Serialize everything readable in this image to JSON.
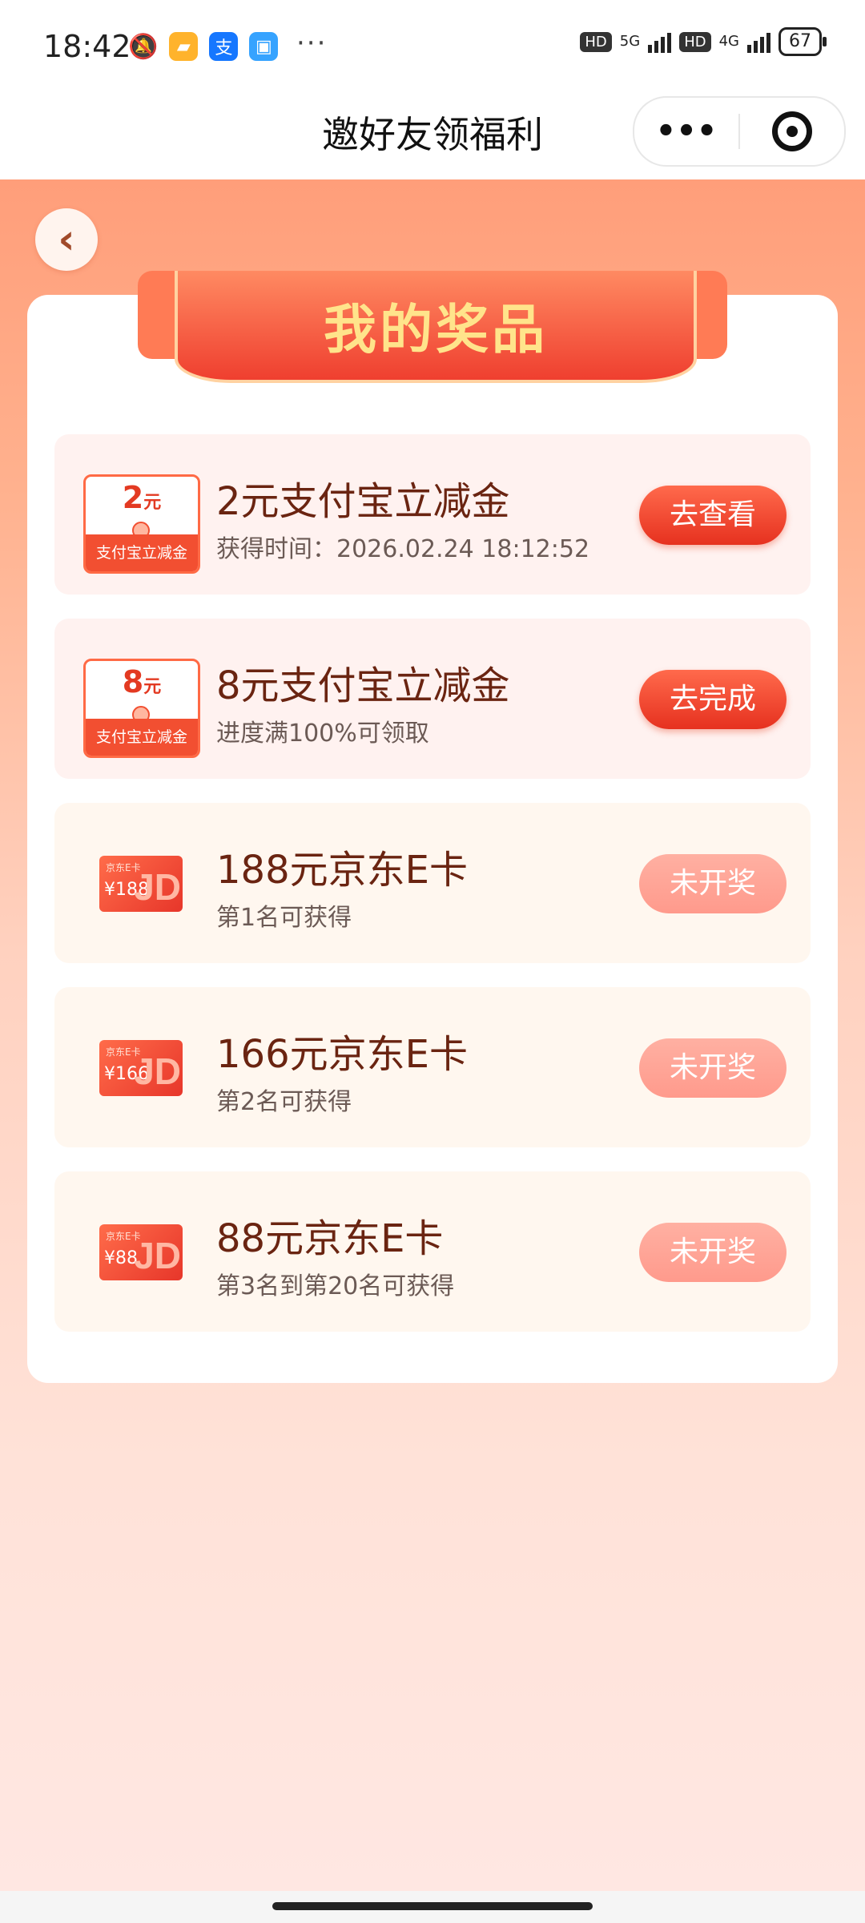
{
  "status_bar": {
    "time": "18:42",
    "hd1": "HD",
    "net1": "5G",
    "hd2": "HD",
    "net2": "4G",
    "battery": "67"
  },
  "header": {
    "title": "邀好友领福利",
    "more_icon": "•••"
  },
  "panel": {
    "title": "我的奖品"
  },
  "prizes": [
    {
      "badge_amount": "2",
      "badge_unit": "元",
      "badge_label": "支付宝立减金",
      "name": "2元支付宝立减金",
      "subtitle": "获得时间：2026.02.24 18:12:52",
      "action": "去查看"
    },
    {
      "badge_amount": "8",
      "badge_unit": "元",
      "badge_label": "支付宝立减金",
      "name": "8元支付宝立减金",
      "subtitle": "进度满100%可领取",
      "action": "去完成"
    },
    {
      "card_label": "京东E卡",
      "card_value": "¥188",
      "name": "188元京东E卡",
      "subtitle": "第1名可获得",
      "action": "未开奖"
    },
    {
      "card_label": "京东E卡",
      "card_value": "¥166",
      "name": "166元京东E卡",
      "subtitle": "第2名可获得",
      "action": "未开奖"
    },
    {
      "card_label": "京东E卡",
      "card_value": "¥88",
      "name": "88元京东E卡",
      "subtitle": "第3名到第20名可获得",
      "action": "未开奖"
    }
  ],
  "colors": {
    "accent": "#ef3f2f",
    "title_gold": "#ffe48b",
    "prize_text": "#6a2411"
  }
}
